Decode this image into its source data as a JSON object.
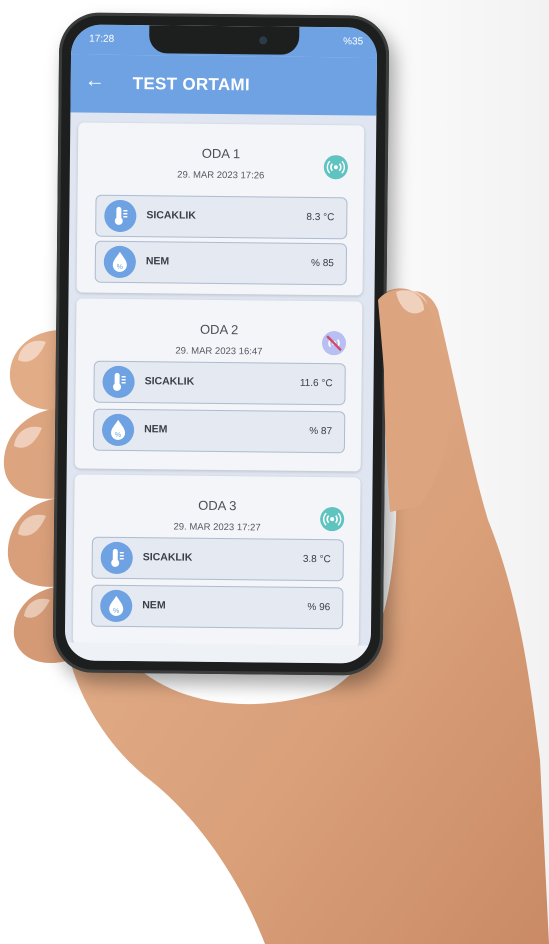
{
  "status_bar": {
    "time": "17:28",
    "battery": "%35"
  },
  "app_bar": {
    "title": "TEST ORTAMI",
    "back_icon": "arrow-left-icon"
  },
  "colors": {
    "primary": "#6ea2e2",
    "online": "#5fc3c0",
    "offline": "#d14a6a"
  },
  "rooms": [
    {
      "name": "ODA 1",
      "date": "29. MAR 2023 17:26",
      "signal": "online",
      "temp_label": "SICAKLIK",
      "temp_value": "8.3 °C",
      "hum_label": "NEM",
      "hum_value": "% 85"
    },
    {
      "name": "ODA 2",
      "date": "29. MAR 2023 16:47",
      "signal": "offline",
      "temp_label": "SICAKLIK",
      "temp_value": "11.6 °C",
      "hum_label": "NEM",
      "hum_value": "% 87"
    },
    {
      "name": "ODA 3",
      "date": "29. MAR 2023 17:27",
      "signal": "online",
      "temp_label": "SICAKLIK",
      "temp_value": "3.8 °C",
      "hum_label": "NEM",
      "hum_value": "% 96"
    }
  ]
}
